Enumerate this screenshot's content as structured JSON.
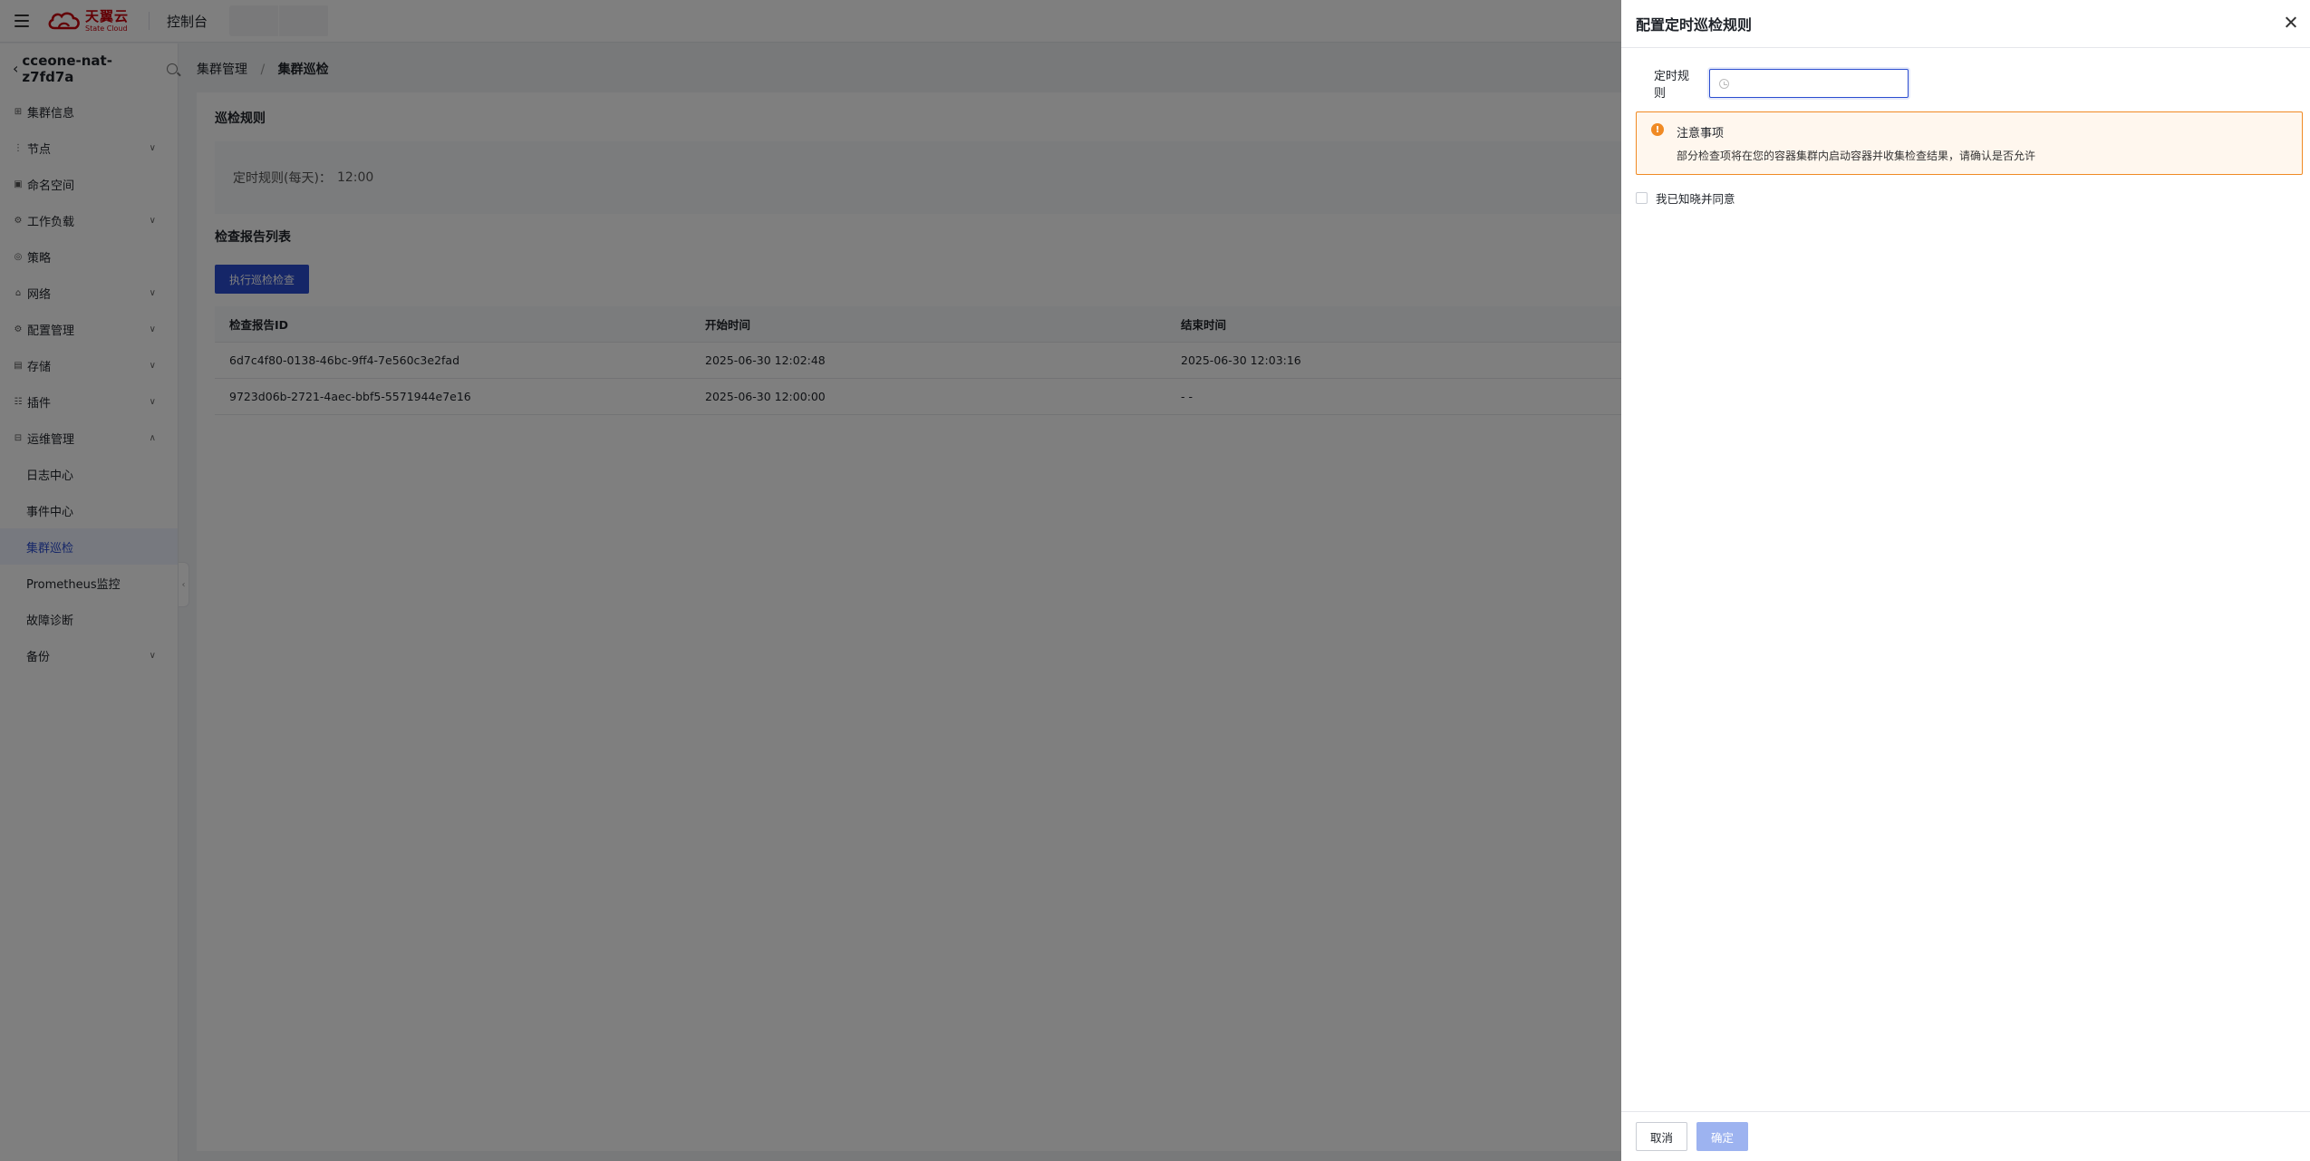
{
  "topbar": {
    "logo_cn": "天翼云",
    "logo_en": "State Cloud",
    "console_label": "控制台"
  },
  "sidebar": {
    "cluster_name": "cceone-nat-z7fd7a",
    "items": [
      {
        "label": "集群信息",
        "icon": "grid-icon"
      },
      {
        "label": "节点",
        "icon": "node-icon"
      },
      {
        "label": "命名空间",
        "icon": "namespace-icon"
      },
      {
        "label": "工作负载",
        "icon": "workload-icon"
      },
      {
        "label": "策略",
        "icon": "policy-icon"
      },
      {
        "label": "网络",
        "icon": "network-icon"
      },
      {
        "label": "配置管理",
        "icon": "config-icon"
      },
      {
        "label": "存储",
        "icon": "storage-icon"
      },
      {
        "label": "插件",
        "icon": "plugin-icon"
      },
      {
        "label": "运维管理",
        "icon": "ops-icon"
      }
    ],
    "sub_items": [
      {
        "label": "日志中心"
      },
      {
        "label": "事件中心"
      },
      {
        "label": "集群巡检"
      },
      {
        "label": "Prometheus监控"
      },
      {
        "label": "故障诊断"
      }
    ],
    "backup_label": "备份"
  },
  "breadcrumb": {
    "parent": "集群管理",
    "separator": "/",
    "current": "集群巡检"
  },
  "main": {
    "rules_title": "巡检规则",
    "rule_label": "定时规则(每天)：",
    "rule_value": "12:00",
    "reports_title": "检查报告列表",
    "exec_button": "执行巡检检查",
    "table": {
      "headers": [
        "检查报告ID",
        "开始时间",
        "结束时间"
      ],
      "rows": [
        [
          "6d7c4f80-0138-46bc-9ff4-7e560c3e2fad",
          "2025-06-30 12:02:48",
          "2025-06-30 12:03:16"
        ],
        [
          "9723d06b-2721-4aec-bbf5-5571944e7e16",
          "2025-06-30 12:00:00",
          "- -"
        ]
      ]
    }
  },
  "drawer": {
    "title": "配置定时巡检规则",
    "form_label": "定时规则",
    "time_value": "",
    "time_placeholder": "",
    "notice_title": "注意事项",
    "notice_text": "部分检查项将在您的容器集群内启动容器并收集检查结果，请确认是否允许",
    "agree_label": "我已知晓并同意",
    "agree_checked": false,
    "cancel_button": "取消",
    "ok_button": "确定"
  },
  "colors": {
    "primary": "#2b4dd0",
    "primary_disabled": "#9db3f0",
    "warning": "#f08a24",
    "brand_red": "#c7000b"
  }
}
